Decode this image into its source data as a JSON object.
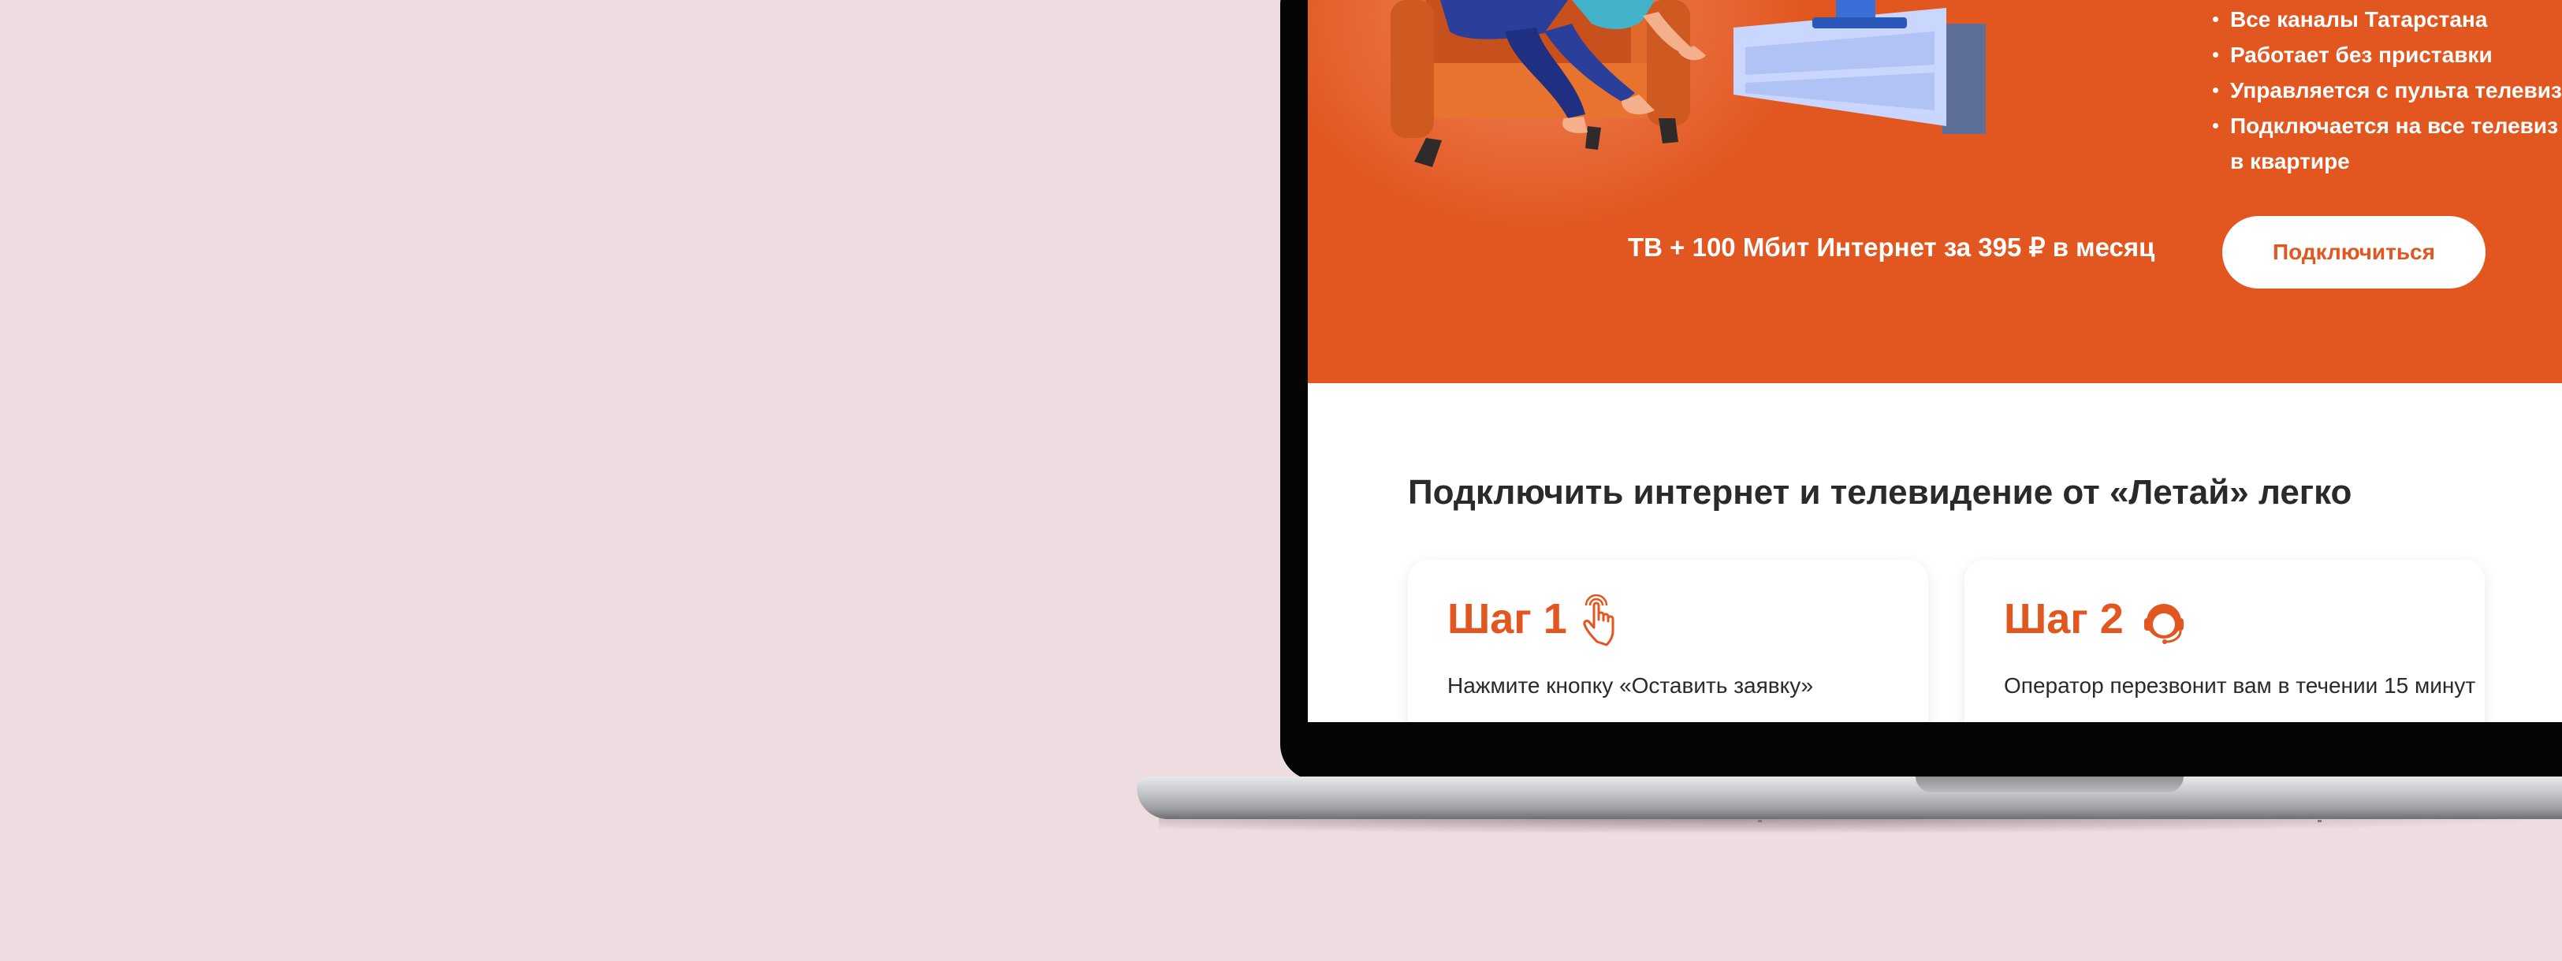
{
  "hero": {
    "features": [
      "Все каналы Татарстана",
      "Работает без приставки",
      "Управляется с пульта телевиз",
      "Подключается на все телевиз"
    ],
    "features_last_line2": "в квартире",
    "offer_text": "ТВ + 100 Мбит Интернет за 395 ₽ в месяц",
    "connect_button_label": "Подключиться"
  },
  "main": {
    "section_title": "Подключить интернет и телевидение от «Летай» легко",
    "steps": [
      {
        "title": "Шаг 1",
        "description": "Нажмите кнопку «Оставить заявку»",
        "icon": "pointer-hand-icon"
      },
      {
        "title": "Шаг 2",
        "description": "Оператор перезвонит вам в течении 15 минут",
        "icon": "operator-headset-icon"
      }
    ]
  },
  "colors": {
    "brand": "#e25620",
    "background": "#eedde0",
    "text_dark": "#2a2a2a"
  }
}
